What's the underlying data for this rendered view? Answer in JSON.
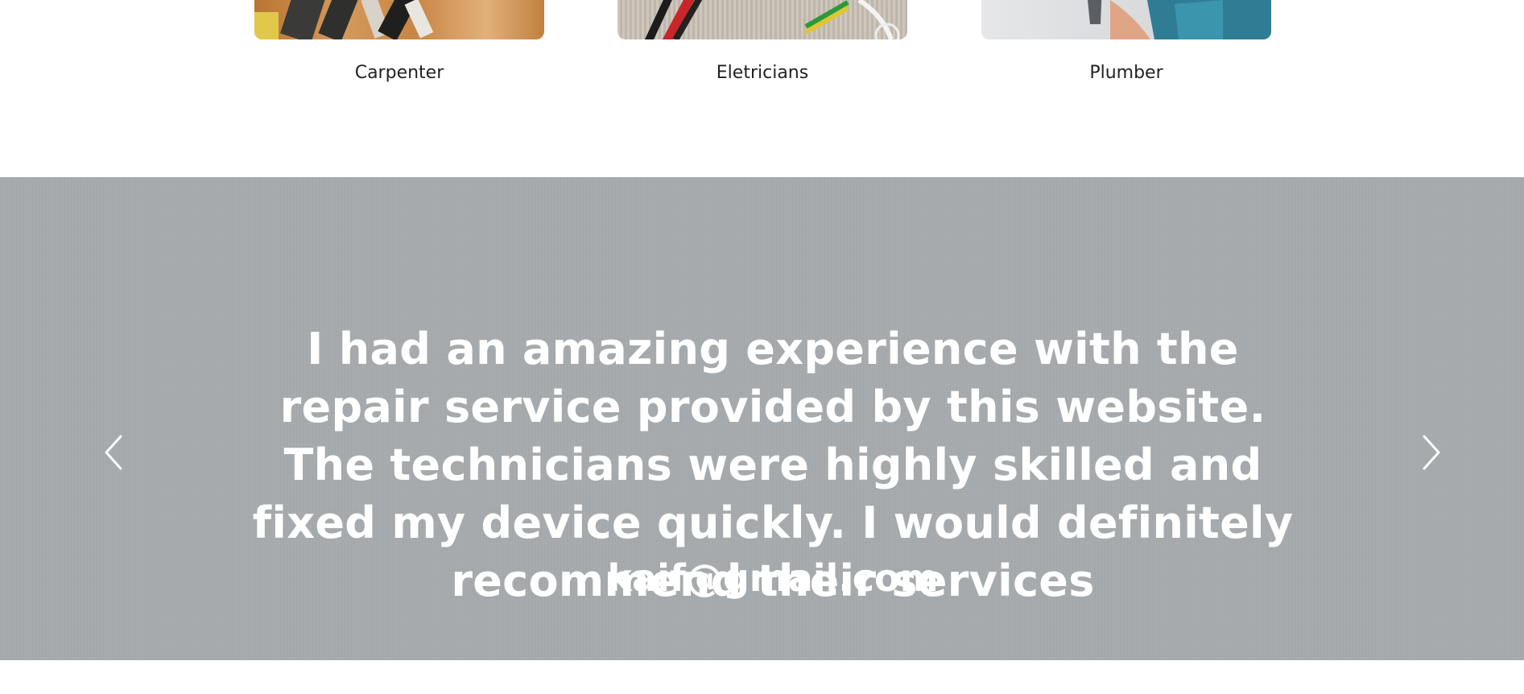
{
  "services": [
    {
      "label": "Carpenter",
      "image_icon": "carpenter-photo"
    },
    {
      "label": "Eletricians",
      "image_icon": "electrician-photo"
    },
    {
      "label": "Plumber",
      "image_icon": "plumber-photo"
    }
  ],
  "testimonial": {
    "quote": "I had an amazing experience with the repair service provided by this website. The technicians were highly skilled and fixed my device quickly. I would definitely recommend their services",
    "author": "kaif@gmail.com",
    "prev_icon": "chevron-left-icon",
    "next_icon": "chevron-right-icon"
  },
  "colors": {
    "banner_bg": "#a6aaac",
    "banner_text": "#ffffff",
    "label_text": "#222222"
  }
}
